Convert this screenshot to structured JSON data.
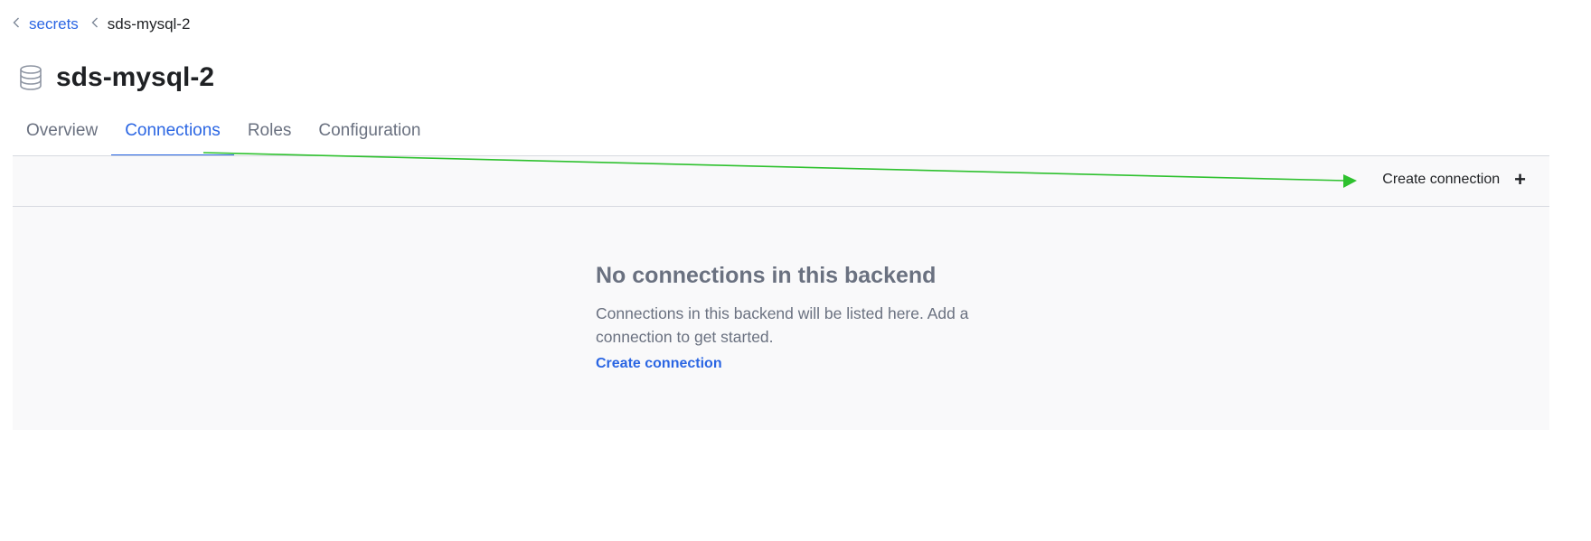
{
  "breadcrumb": {
    "items": [
      {
        "label": "secrets"
      },
      {
        "label": "sds-mysql-2"
      }
    ]
  },
  "header": {
    "title": "sds-mysql-2",
    "icon": "database-icon"
  },
  "tabs": [
    {
      "label": "Overview",
      "active": false
    },
    {
      "label": "Connections",
      "active": true
    },
    {
      "label": "Roles",
      "active": false
    },
    {
      "label": "Configuration",
      "active": false
    }
  ],
  "toolbar": {
    "create_label": "Create connection",
    "create_icon": "plus-icon"
  },
  "empty_state": {
    "title": "No connections in this backend",
    "body": "Connections in this backend will be listed here. Add a connection to get started.",
    "link": "Create connection"
  },
  "colors": {
    "accent": "#2b66e3",
    "annotation_arrow": "#2ec12e",
    "panel_bg": "#f9f9fa"
  }
}
